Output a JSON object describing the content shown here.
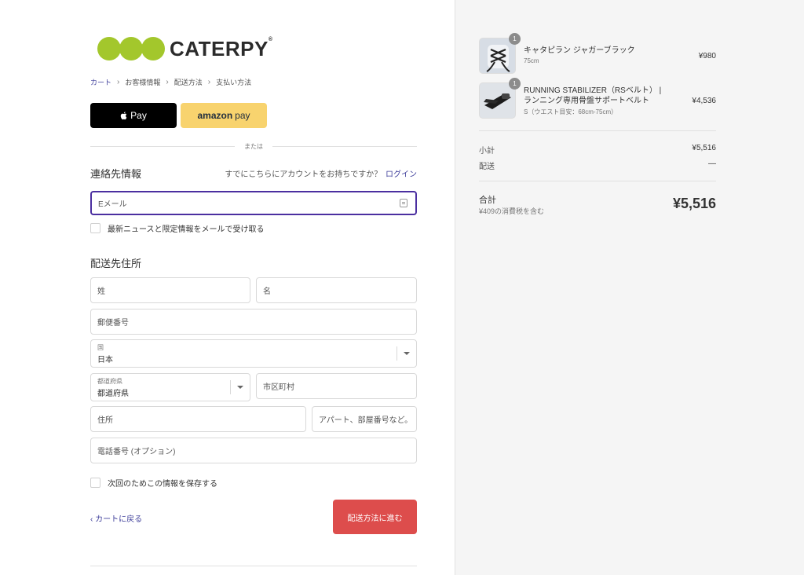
{
  "brand": {
    "name": "CATERPY",
    "reg": "®"
  },
  "breadcrumb": [
    "カート",
    "お客様情報",
    "配送方法",
    "支払い方法"
  ],
  "express": {
    "apple_pay": "Pay",
    "amazon_pay_bold": "amazon",
    "amazon_pay": "pay",
    "or": "または"
  },
  "contact": {
    "title": "連絡先情報",
    "account_question": "すでにこちらにアカウントをお持ちですか？",
    "login": "ログイン",
    "email_placeholder": "Eメール",
    "newsletter": "最新ニュースと限定情報をメールで受け取る"
  },
  "shipping": {
    "title": "配送先住所",
    "last_name": "姓",
    "first_name": "名",
    "postal": "郵便番号",
    "country_label": "国",
    "country_value": "日本",
    "prefecture_label": "都道府県",
    "prefecture_value": "都道府県",
    "city": "市区町村",
    "address": "住所",
    "apartment": "アパート、部屋番号など。",
    "phone": "電話番号 (オプション)",
    "save_info": "次回のためこの情報を保存する"
  },
  "actions": {
    "back": "カートに戻る",
    "next": "配送方法に進む"
  },
  "cart": {
    "items": [
      {
        "qty": "1",
        "name": "キャタピラン ジャガーブラック",
        "variant": "75cm",
        "price": "¥980"
      },
      {
        "qty": "1",
        "name": "RUNNING STABILIZER（RSベルト） | ランニング専用骨盤サポートベルト",
        "variant": "S（ウエスト目安：68cm-75cm）",
        "price": "¥4,536"
      }
    ],
    "subtotal_label": "小計",
    "subtotal": "¥5,516",
    "shipping_label": "配送",
    "shipping": "—",
    "total_label": "合計",
    "tax_note": "¥409の消費税を含む",
    "total": "¥5,516"
  },
  "colors": {
    "accent": "#4b2fa0",
    "link": "#3f3f9b",
    "cta": "#dd4d4c",
    "logo_green": "#a3c72c",
    "amazon": "#f8d36e"
  }
}
